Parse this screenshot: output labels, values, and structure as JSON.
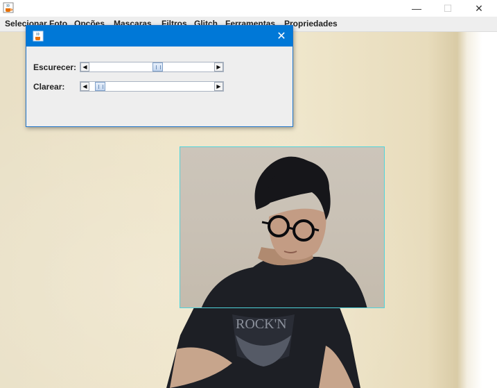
{
  "window": {
    "icon": "java-cup-icon",
    "controls": {
      "minimize": "—",
      "maximize": "☐",
      "close": "✕"
    }
  },
  "menu": {
    "items": [
      "Selecionar Foto",
      "Opções",
      "Mascaras",
      "Filtros",
      "Glitch",
      "Ferramentas",
      "Propriedades"
    ]
  },
  "dialog": {
    "icon": "java-cup-icon",
    "close": "✕",
    "sliders": [
      {
        "label": "Escurecer:",
        "value": 0.55
      },
      {
        "label": "Clarear:",
        "value": 0.05
      }
    ]
  },
  "colors": {
    "dialog_title": "#0078d7",
    "photo_border": "#4fd4dc",
    "wall": "#eee4c8"
  }
}
